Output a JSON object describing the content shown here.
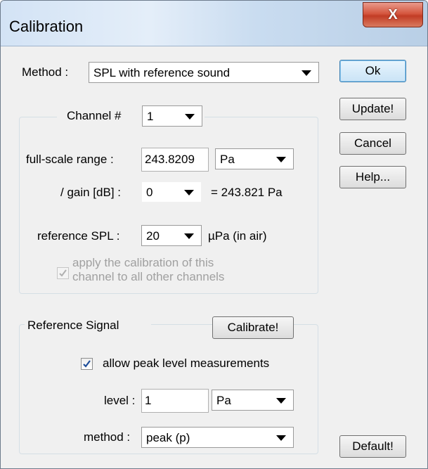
{
  "window": {
    "title": "Calibration",
    "close_glyph": "X"
  },
  "method": {
    "label": "Method :",
    "value": "SPL with reference sound"
  },
  "channel_group": {
    "label": "Channel #",
    "channel_value": "1",
    "full_scale_label": "full-scale range :",
    "full_scale_value": "243.8209",
    "full_scale_unit": "Pa",
    "gain_label": "/ gain [dB] :",
    "gain_value": "0",
    "gain_result": "= 243.821 Pa",
    "ref_spl_label": "reference SPL :",
    "ref_spl_value": "20",
    "ref_spl_unit": "µPa  (in air)",
    "apply_all_line1": "apply the calibration of this",
    "apply_all_line2": "channel to all other channels",
    "apply_all_checked": true
  },
  "reference_group": {
    "label": "Reference Signal",
    "calibrate_button": "Calibrate!",
    "allow_peak_label": "allow peak level measurements",
    "allow_peak_checked": true,
    "level_label": "level :",
    "level_value": "1",
    "level_unit": "Pa",
    "method_label": "method :",
    "method_value": "peak (p)"
  },
  "buttons": {
    "ok": "Ok",
    "update": "Update!",
    "cancel": "Cancel",
    "help": "Help...",
    "default": "Default!"
  }
}
